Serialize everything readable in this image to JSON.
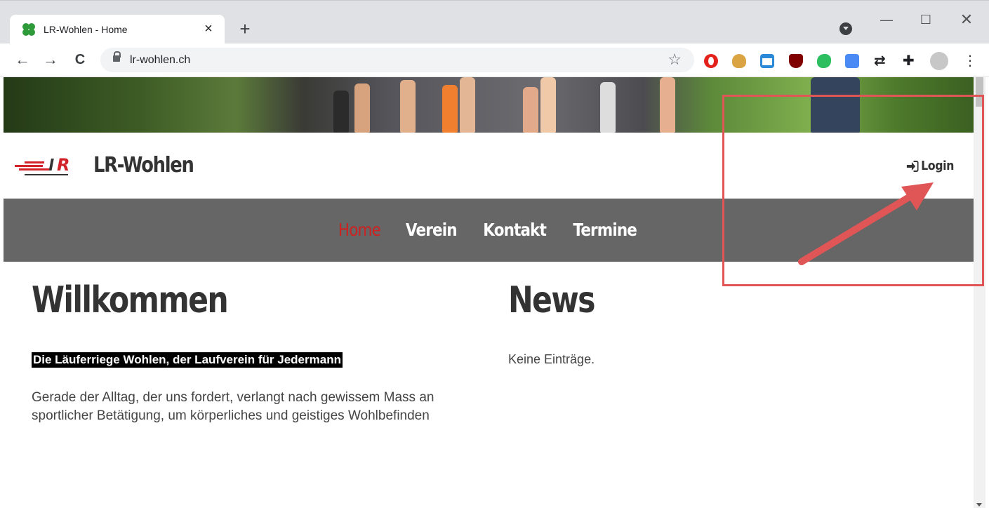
{
  "browser": {
    "tab_title": "LR-Wohlen - Home",
    "tab_close": "×",
    "new_tab": "+",
    "url": "lr-wohlen.ch",
    "window_buttons": {
      "minimize": "—",
      "maximize": "☐",
      "close": "✕"
    },
    "nav": {
      "back": "←",
      "forward": "→",
      "reload": "C"
    },
    "bookmark_icon": "☆",
    "menu_icon": "⋮",
    "extensions": [
      "opera-icon",
      "fox-icon",
      "window-icon",
      "ublock-icon",
      "evernote-icon",
      "translate-icon",
      "sync-icon",
      "puzzle-icon"
    ],
    "sync_glyph": "⇄",
    "puzzle_glyph": "✚"
  },
  "site": {
    "name": "LR-Wohlen",
    "login_label": "Login",
    "menu": [
      {
        "label": "Home",
        "active": true
      },
      {
        "label": "Verein",
        "active": false
      },
      {
        "label": "Kontakt",
        "active": false
      },
      {
        "label": "Termine",
        "active": false
      }
    ],
    "accent_color": "#cc2222",
    "nav_bg_color": "#666666"
  },
  "main": {
    "welcome_heading": "Willkommen",
    "tagline": "Die Läuferriege Wohlen, der Laufverein für Jedermann",
    "intro_text": "Gerade der Alltag, der uns fordert, verlangt nach gewissem Mass an sportlicher Betätigung, um körperliches und geistiges Wohlbefinden",
    "news_heading": "News",
    "news_empty": "Keine Einträge."
  },
  "annotation": {
    "color": "#e05555"
  }
}
